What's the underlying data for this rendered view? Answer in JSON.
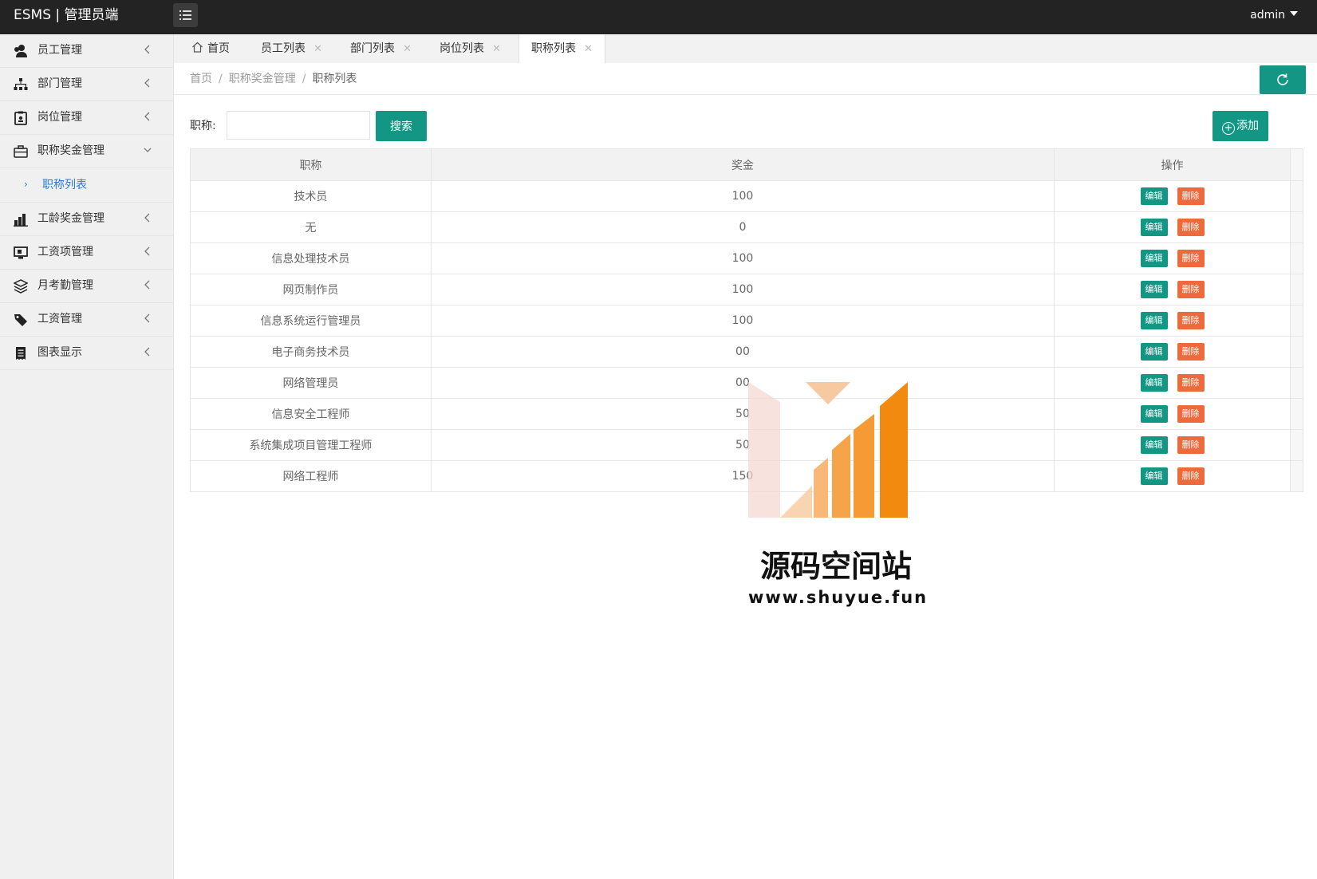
{
  "app": {
    "title": "ESMS | 管理员端",
    "user": "admin"
  },
  "sidebar": {
    "items": [
      {
        "label": "员工管理",
        "icon": "users-icon"
      },
      {
        "label": "部门管理",
        "icon": "sitemap-icon"
      },
      {
        "label": "岗位管理",
        "icon": "badge-icon"
      },
      {
        "label": "职称奖金管理",
        "icon": "briefcase-icon",
        "expanded": true,
        "sub": [
          {
            "label": "职称列表"
          }
        ]
      },
      {
        "label": "工龄奖金管理",
        "icon": "chart-icon"
      },
      {
        "label": "工资项管理",
        "icon": "monitor-icon"
      },
      {
        "label": "月考勤管理",
        "icon": "layers-icon"
      },
      {
        "label": "工资管理",
        "icon": "tags-icon"
      },
      {
        "label": "图表显示",
        "icon": "receipt-icon"
      }
    ]
  },
  "tabs": [
    {
      "label": "首页",
      "closable": false
    },
    {
      "label": "员工列表",
      "closable": true
    },
    {
      "label": "部门列表",
      "closable": true
    },
    {
      "label": "岗位列表",
      "closable": true
    },
    {
      "label": "职称列表",
      "closable": true,
      "active": true
    }
  ],
  "breadcrumb": {
    "items": [
      "首页",
      "职称奖金管理",
      "职称列表"
    ]
  },
  "search": {
    "label": "职称:",
    "value": "",
    "placeholder": "",
    "button": "搜索"
  },
  "actions": {
    "add": "添加"
  },
  "table": {
    "columns": [
      "职称",
      "奖金",
      "操作"
    ],
    "edit_label": "编辑",
    "delete_label": "删除",
    "rows": [
      {
        "title": "技术员",
        "bonus": "100"
      },
      {
        "title": "无",
        "bonus": "0"
      },
      {
        "title": "信息处理技术员",
        "bonus": "100"
      },
      {
        "title": "网页制作员",
        "bonus": "100"
      },
      {
        "title": "信息系统运行管理员",
        "bonus": "100"
      },
      {
        "title": "电子商务技术员",
        "bonus": "00"
      },
      {
        "title": "网络管理员",
        "bonus": "00"
      },
      {
        "title": "信息安全工程师",
        "bonus": "50"
      },
      {
        "title": "系统集成项目管理工程师",
        "bonus": "50"
      },
      {
        "title": "网络工程师",
        "bonus": "150"
      }
    ]
  },
  "watermark": {
    "title": "源码空间站",
    "url": "www.shuyue.fun"
  },
  "colors": {
    "primary": "#139784",
    "danger": "#ec6a3c",
    "topbar": "#232323",
    "link": "#2a7ae2"
  }
}
